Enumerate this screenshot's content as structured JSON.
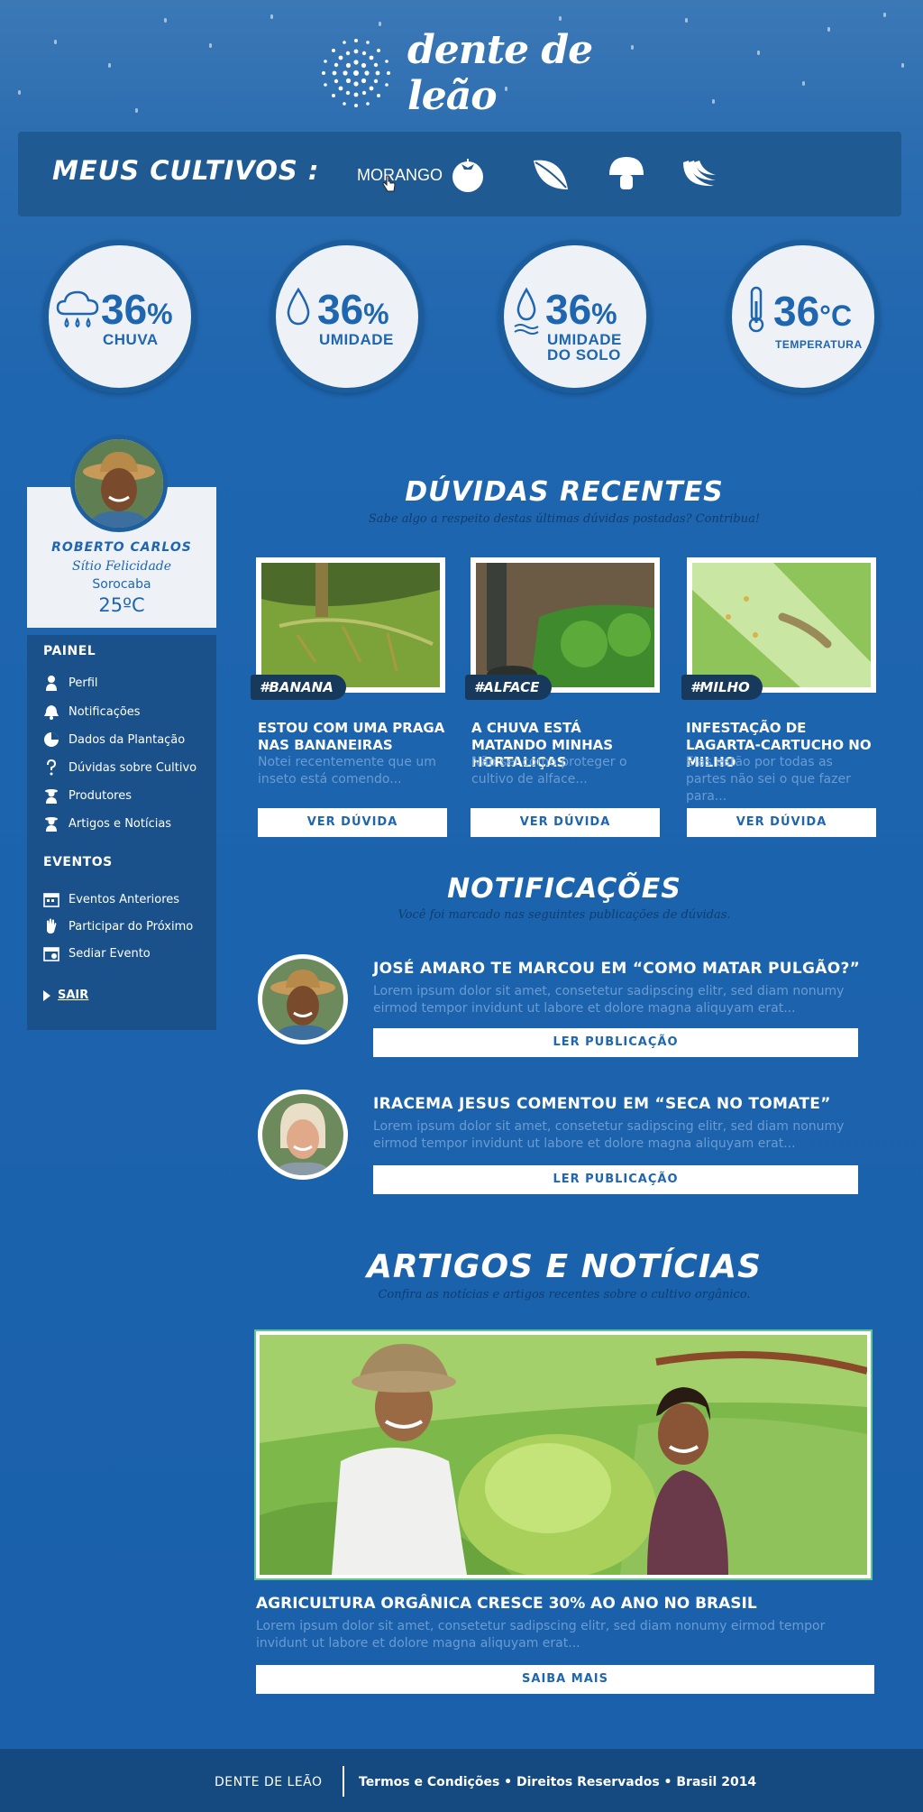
{
  "brand": {
    "name": "dente de leão"
  },
  "cultivos": {
    "title": "MEUS CULTIVOS :",
    "crops": [
      {
        "label": "MORANGO",
        "icon": "strawberry-icon"
      },
      {
        "icon": "tomato-icon"
      },
      {
        "icon": "leaf-icon"
      },
      {
        "icon": "mushroom-icon"
      },
      {
        "icon": "banana-icon"
      }
    ]
  },
  "stats": [
    {
      "value": "36",
      "unit": "%",
      "label1": "CHUVA",
      "label2": "",
      "icon": "rain-cloud-icon"
    },
    {
      "value": "36",
      "unit": "%",
      "label1": "UMIDADE",
      "label2": "",
      "icon": "water-drop-icon"
    },
    {
      "value": "36",
      "unit": "%",
      "label1": "UMIDADE",
      "label2": "DO SOLO",
      "icon": "soil-moisture-icon"
    },
    {
      "value": "36",
      "unit": "°C",
      "label1": "TEMPERATURA",
      "label2": "",
      "icon": "thermometer-icon"
    }
  ],
  "profile": {
    "name": "ROBERTO CARLOS",
    "farm": "Sítio Felicidade",
    "city": "Sorocaba",
    "temperature": "25ºC"
  },
  "sidebar": {
    "painel_heading": "PAINEL",
    "painel_items": [
      {
        "label": "Perfil",
        "icon": "person-icon"
      },
      {
        "label": "Notificações",
        "icon": "bell-icon"
      },
      {
        "label": "Dados da Plantação",
        "icon": "pie-chart-icon"
      },
      {
        "label": "Dúvidas sobre Cultivo",
        "icon": "question-icon"
      },
      {
        "label": "Produtores",
        "icon": "farmer-icon"
      },
      {
        "label": "Artigos e Notícias",
        "icon": "article-icon"
      }
    ],
    "eventos_heading": "EVENTOS",
    "eventos_items": [
      {
        "label": "Eventos Anteriores",
        "icon": "calendar-icon"
      },
      {
        "label": "Participar do Próximo",
        "icon": "hand-icon"
      },
      {
        "label": "Sediar Evento",
        "icon": "calendar-host-icon"
      }
    ],
    "logout": "SAIR"
  },
  "duvidas": {
    "title": "DÚVIDAS RECENTES",
    "subtitle": "Sabe algo a respeito destas últimas dúvidas postadas? Contribua!",
    "cards": [
      {
        "tag": "#BANANA",
        "title": "ESTOU COM UMA PRAGA NAS BANANEIRAS",
        "text": "Notei recentemente que um inseto está comendo...",
        "button": "VER DÚVIDA"
      },
      {
        "tag": "#ALFACE",
        "title": "A CHUVA ESTÁ MATANDO MINHAS HORTALIÇAS",
        "text": "Não sei como proteger o cultivo de alface...",
        "button": "VER DÚVIDA"
      },
      {
        "tag": "#MILHO",
        "title": "INFESTAÇÃO DE LAGARTA-CARTUCHO NO MILHO",
        "text": "Elas estão por todas as partes não sei o que fazer para...",
        "button": "VER DÚVIDA"
      }
    ]
  },
  "notificacoes": {
    "title": "NOTIFICAÇÕES",
    "subtitle": "Você foi marcado nas seguintes publicações de dúvidas.",
    "items": [
      {
        "title": "JOSÉ AMARO TE MARCOU EM “COMO MATAR PULGÃO?”",
        "text": "Lorem ipsum dolor sit amet, consetetur sadipscing elitr, sed diam nonumy eirmod tempor invidunt ut labore et dolore magna aliquyam erat...",
        "button": "LER PUBLICAÇÃO"
      },
      {
        "title": "IRACEMA JESUS COMENTOU EM “SECA NO TOMATE”",
        "text": "Lorem ipsum dolor sit amet, consetetur sadipscing elitr, sed diam nonumy eirmod tempor invidunt ut labore et dolore magna aliquyam erat...",
        "button": "LER PUBLICAÇÃO"
      }
    ]
  },
  "artigos": {
    "title": "ARTIGOS E NOTÍCIAS",
    "subtitle": "Confira as notícias e artigos recentes sobre o cultivo orgânico.",
    "article_title": "AGRICULTURA ORGÂNICA CRESCE 30% AO ANO NO BRASIL",
    "article_text": "Lorem ipsum dolor sit amet, consetetur sadipscing elitr, sed diam nonumy eirmod tempor invidunt ut labore et dolore magna aliquyam erat...",
    "button": "SAIBA MAIS"
  },
  "footer": {
    "brand": "DENTE DE LEÃO",
    "legal": "Termos e Condições • Direitos Reservados • Brasil 2014"
  },
  "colors": {
    "background": "#1f66b0",
    "panel": "#1a518a",
    "card": "#eef1f5",
    "accent_text": "#1f66b0",
    "muted_text": "#6a9cd1"
  }
}
